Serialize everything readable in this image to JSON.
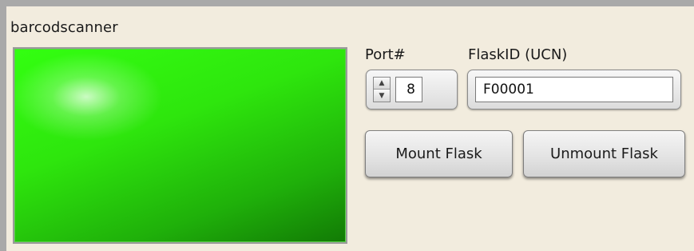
{
  "panel": {
    "title": "barcodscanner"
  },
  "indicator": {
    "color": "#33ff11",
    "state": "on"
  },
  "port": {
    "label": "Port#",
    "value": "8"
  },
  "flask": {
    "label": "FlaskID (UCN)",
    "value": "F00001"
  },
  "buttons": {
    "mount": "Mount Flask",
    "unmount": "Unmount Flask"
  },
  "icons": {
    "spin_up": "▲",
    "spin_down": "▼"
  }
}
